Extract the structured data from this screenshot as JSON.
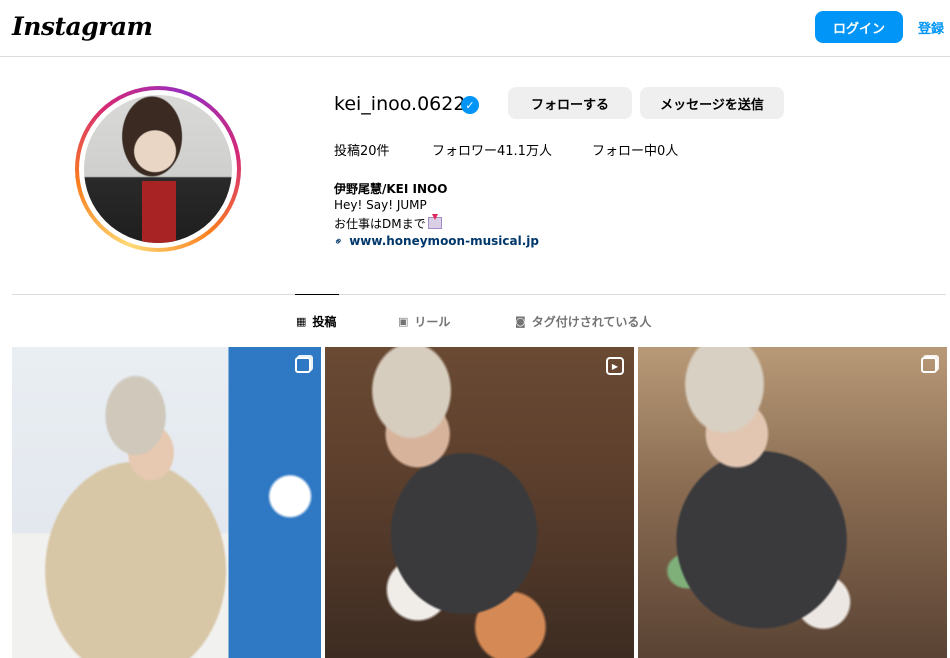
{
  "header": {
    "logo": "Instagram",
    "login_label": "ログイン",
    "signup_label": "登録"
  },
  "profile": {
    "username": "kei_inoo.0622",
    "verified": true,
    "follow_label": "フォローする",
    "message_label": "メッセージを送信",
    "stats": {
      "posts": "投稿20件",
      "followers": "フォロワー41.1万人",
      "following": "フォロー中0人"
    },
    "bio": {
      "name": "伊野尾慧/KEI INOO",
      "line1": "Hey! Say! JUMP",
      "line2": "お仕事はDMまで",
      "line2_emoji": "envelope-with-arrow-icon",
      "link": "www.honeymoon-musical.jp"
    }
  },
  "tabs": [
    {
      "label": "投稿",
      "icon": "grid-icon",
      "active": true
    },
    {
      "label": "リール",
      "icon": "reels-icon",
      "active": false
    },
    {
      "label": "タグ付けされている人",
      "icon": "tagged-icon",
      "active": false
    }
  ],
  "posts": [
    {
      "type": "carousel",
      "badge_icon": "carousel-icon"
    },
    {
      "type": "reel",
      "badge_icon": "reel-icon"
    },
    {
      "type": "carousel",
      "badge_icon": "carousel-icon"
    }
  ],
  "colors": {
    "accent": "#0095f6",
    "link": "#00376b",
    "button_gray": "#efefef",
    "muted_text": "#737373",
    "divider": "#dbdbdb"
  }
}
